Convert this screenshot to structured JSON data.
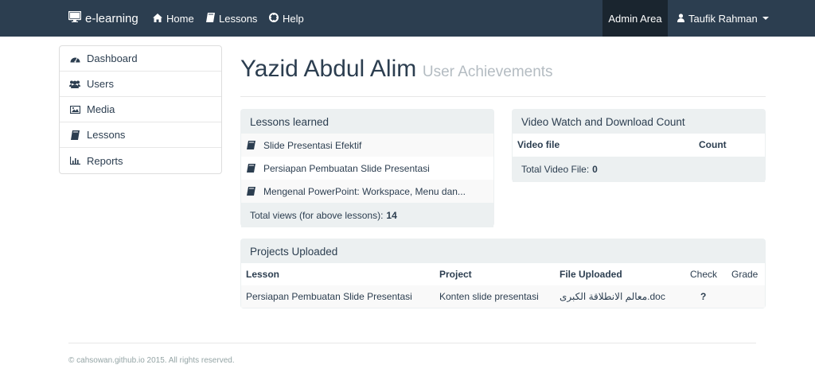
{
  "nav": {
    "brand": "e-learning",
    "home": "Home",
    "lessons": "Lessons",
    "help": "Help",
    "admin": "Admin Area",
    "user": "Taufik Rahman"
  },
  "sidebar": {
    "items": [
      {
        "label": "Dashboard",
        "icon": "dashboard-icon"
      },
      {
        "label": "Users",
        "icon": "users-icon"
      },
      {
        "label": "Media",
        "icon": "picture-icon"
      },
      {
        "label": "Lessons",
        "icon": "book-icon"
      },
      {
        "label": "Reports",
        "icon": "bar-chart-icon"
      }
    ]
  },
  "header": {
    "title": "Yazid Abdul Alim",
    "subtitle": "User Achievements"
  },
  "lessons_panel": {
    "heading": "Lessons learned",
    "items": [
      "Slide Presentasi Efektif",
      "Persiapan Pembuatan Slide Presentasi",
      "Mengenal PowerPoint: Workspace, Menu dan..."
    ],
    "total_label": "Total views (for above lessons):",
    "total_value": "14"
  },
  "video_panel": {
    "heading": "Video Watch and Download Count",
    "col_video": "Video file",
    "col_count": "Count",
    "total_label": "Total Video File:",
    "total_value": "0"
  },
  "projects_panel": {
    "heading": "Projects Uploaded",
    "columns": [
      "Lesson",
      "Project",
      "File Uploaded",
      "Check",
      "Grade"
    ],
    "rows": [
      {
        "lesson": "Persiapan Pembuatan Slide Presentasi",
        "project": "Konten slide presentasi",
        "file": "معالم الانطلاقة الكبرى.doc",
        "check": "?",
        "grade": ""
      }
    ]
  },
  "footer": {
    "text": "© cahsowan.github.io 2015. All rights reserved."
  },
  "colors": {
    "navbar": "#2c3e50",
    "admin_active": "#1a252f",
    "panel_heading": "#ecf0f1",
    "muted": "#b4bcc2"
  }
}
